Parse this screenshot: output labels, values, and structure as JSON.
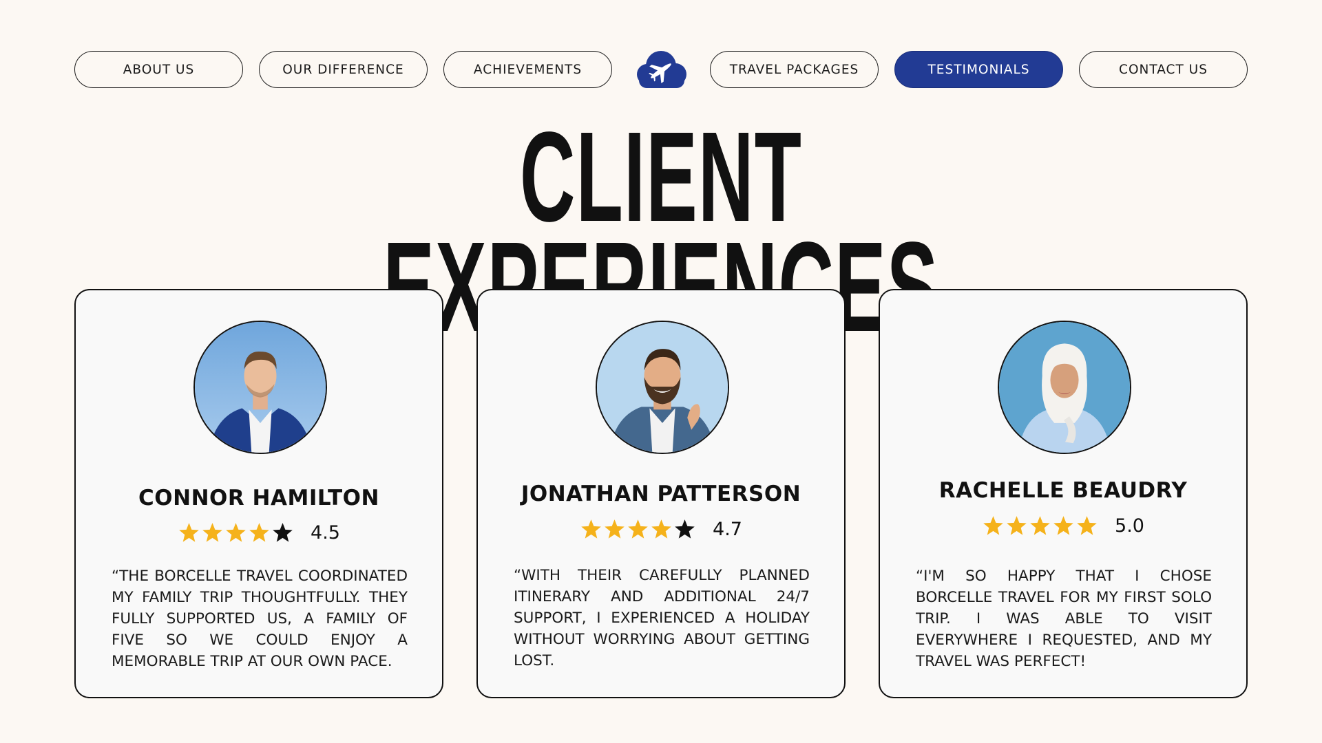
{
  "nav": {
    "items": [
      {
        "label": "ABOUT US"
      },
      {
        "label": "OUR DIFFERENCE"
      },
      {
        "label": "ACHIEVEMENTS"
      },
      {
        "label": "TRAVEL PACKAGES"
      },
      {
        "label": "TESTIMONIALS",
        "active": true
      },
      {
        "label": "CONTACT US"
      }
    ],
    "logo_icon": "cloud-airplane-icon",
    "active_color": "#223b94"
  },
  "page": {
    "title": "CLIENT EXPERIENCES"
  },
  "testimonials": [
    {
      "name": "CONNOR HAMILTON",
      "rating": 4.5,
      "rating_label": "4.5",
      "stars_filled": 4,
      "quote": "“THE BORCELLE TRAVEL COORDINATED MY FAMILY TRIP THOUGHTFULLY. THEY FULLY SUPPORTED US, A FAMILY OF FIVE SO WE COULD ENJOY A MEMORABLE TRIP AT OUR OWN PACE."
    },
    {
      "name": "JONATHAN PATTERSON",
      "rating": 4.7,
      "rating_label": "4.7",
      "stars_filled": 4,
      "quote": "“WITH THEIR CAREFULLY PLANNED ITINERARY AND ADDITIONAL 24/7 SUPPORT, I EXPERIENCED A HOLIDAY WITHOUT WORRYING ABOUT GETTING LOST."
    },
    {
      "name": "RACHELLE BEAUDRY",
      "rating": 5.0,
      "rating_label": "5.0",
      "stars_filled": 5,
      "quote": "“I'M SO HAPPY THAT I CHOSE BORCELLE TRAVEL FOR MY FIRST SOLO TRIP. I WAS ABLE TO VISIT EVERYWHERE I REQUESTED, AND MY TRAVEL WAS PERFECT!"
    }
  ],
  "colors": {
    "background": "#fcf8f3",
    "star_filled": "#f5b21b",
    "star_empty": "#111111",
    "card_bg": "#f9f9f9"
  }
}
